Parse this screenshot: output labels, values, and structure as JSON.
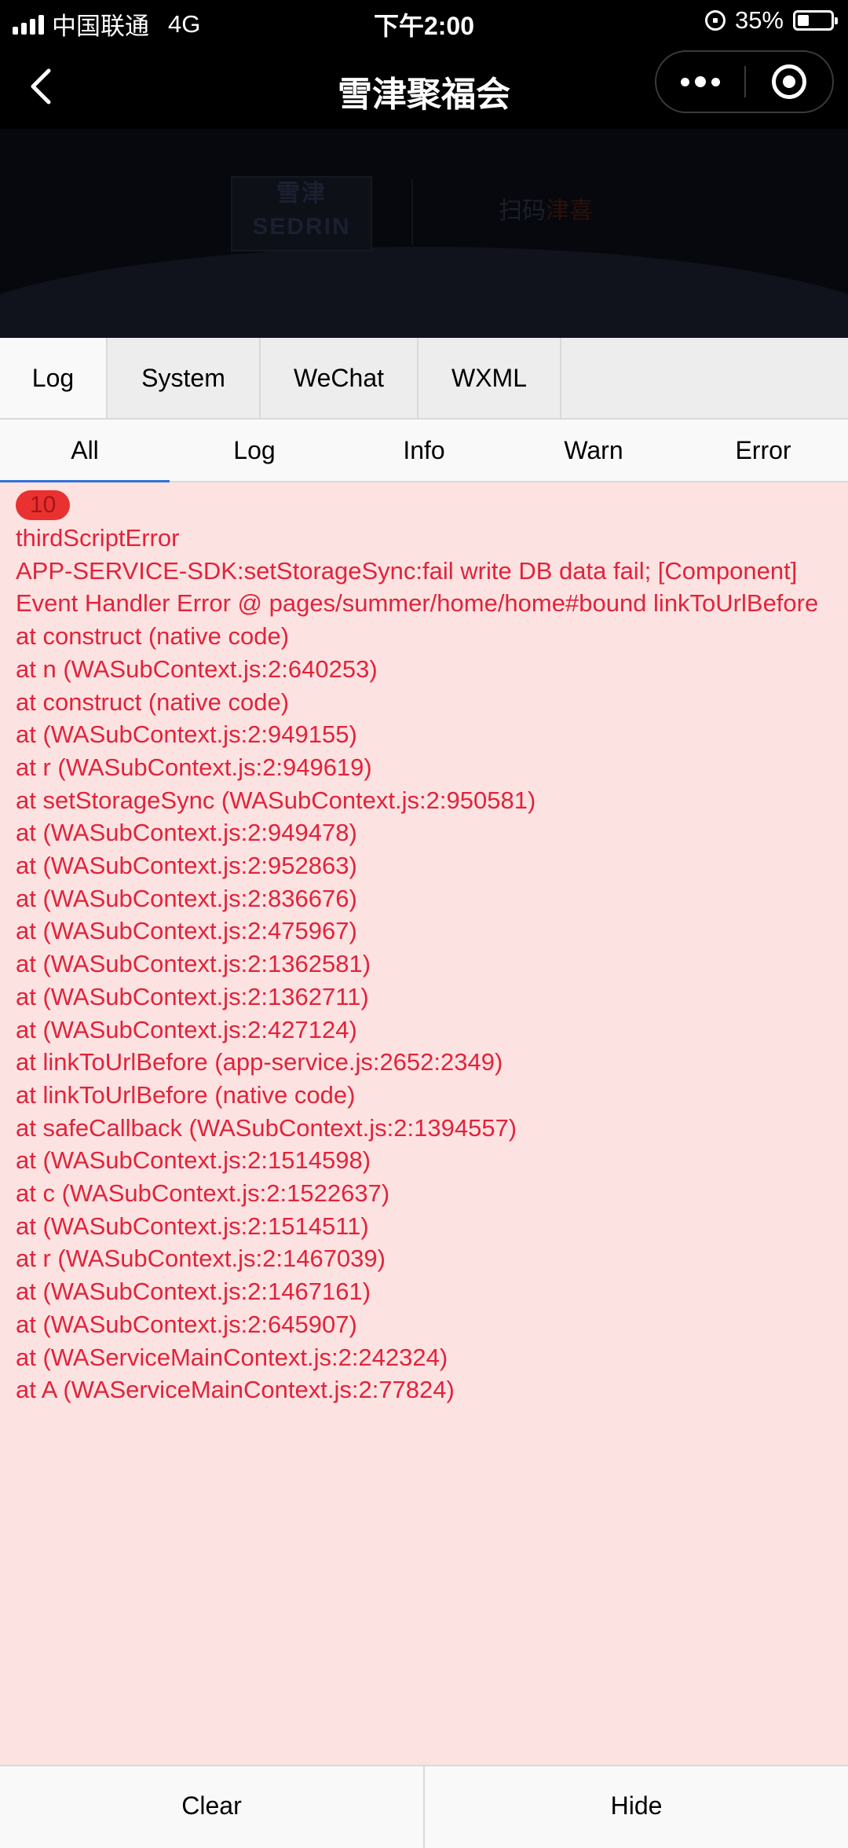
{
  "status_bar": {
    "carrier": "中国联通",
    "network": "4G",
    "time": "下午2:00",
    "battery": "35%",
    "battery_level": 0.35
  },
  "nav": {
    "title": "雪津聚福会",
    "back_icon": "chevron-left-icon",
    "more_icon": "more-dots-icon",
    "close_icon": "close-target-icon"
  },
  "banner": {
    "left_logo": "雪津 SEDRIN",
    "right_logo_prefix": "扫码",
    "right_logo_highlight": "津喜"
  },
  "console": {
    "tabs": [
      {
        "label": "Log"
      },
      {
        "label": "System"
      },
      {
        "label": "WeChat"
      },
      {
        "label": "WXML"
      }
    ],
    "active_tab": "Log",
    "filters": [
      {
        "label": "All"
      },
      {
        "label": "Log"
      },
      {
        "label": "Info"
      },
      {
        "label": "Warn"
      },
      {
        "label": "Error"
      }
    ],
    "active_filter": "All",
    "log": {
      "repeat_count": "10",
      "title": "thirdScriptError",
      "message": "APP-SERVICE-SDK:setStorageSync:fail write DB data fail; [Component] Event Handler Error @ pages/summer/home/home#bound linkToUrlBefore",
      "stack": [
        "at construct (native code)",
        "at n (WASubContext.js:2:640253)",
        "at construct (native code)",
        "at (WASubContext.js:2:949155)",
        "at r (WASubContext.js:2:949619)",
        "at setStorageSync (WASubContext.js:2:950581)",
        "at (WASubContext.js:2:949478)",
        "at (WASubContext.js:2:952863)",
        "at (WASubContext.js:2:836676)",
        "at (WASubContext.js:2:475967)",
        "at (WASubContext.js:2:1362581)",
        "at (WASubContext.js:2:1362711)",
        "at (WASubContext.js:2:427124)",
        "at linkToUrlBefore (app-service.js:2652:2349)",
        "at linkToUrlBefore (native code)",
        "at safeCallback (WASubContext.js:2:1394557)",
        "at (WASubContext.js:2:1514598)",
        "at c (WASubContext.js:2:1522637)",
        "at (WASubContext.js:2:1514511)",
        "at r (WASubContext.js:2:1467039)",
        "at (WASubContext.js:2:1467161)",
        "at (WASubContext.js:2:645907)",
        "at (WAServiceMainContext.js:2:242324)",
        "at A (WAServiceMainContext.js:2:77824)"
      ]
    },
    "footer": {
      "clear_label": "Clear",
      "hide_label": "Hide"
    }
  },
  "colors": {
    "error_text": "#e0243a",
    "error_bg": "#fde2e2",
    "badge_bg": "#e9322f",
    "active_tab_underline": "#2f73d8"
  }
}
